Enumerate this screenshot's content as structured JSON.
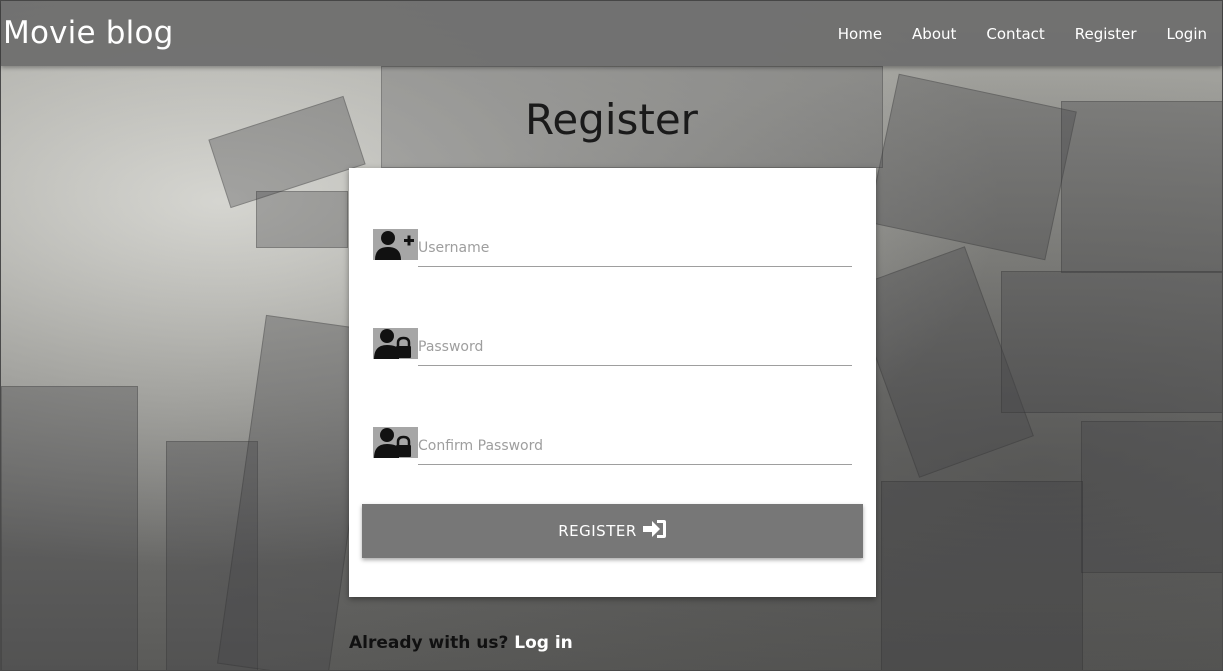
{
  "navbar": {
    "brand": "Movie blog",
    "links": [
      {
        "label": "Home"
      },
      {
        "label": "About"
      },
      {
        "label": "Contact"
      },
      {
        "label": "Register"
      },
      {
        "label": "Login"
      }
    ]
  },
  "page": {
    "title": "Register"
  },
  "form": {
    "username": {
      "placeholder": "Username",
      "value": "",
      "icon": "user-plus-icon"
    },
    "password": {
      "placeholder": "Password",
      "value": "",
      "icon": "user-lock-icon"
    },
    "confirm_password": {
      "placeholder": "Confirm Password",
      "value": "",
      "icon": "user-lock-icon"
    },
    "submit_label": "REGISTER",
    "submit_icon": "sign-in-icon"
  },
  "footer": {
    "prompt": "Already with us?",
    "login_link": "Log in"
  },
  "colors": {
    "navbar": "#6e6e6e",
    "button": "#777777",
    "icon_box": "#a6a6a6",
    "card": "#ffffff"
  }
}
